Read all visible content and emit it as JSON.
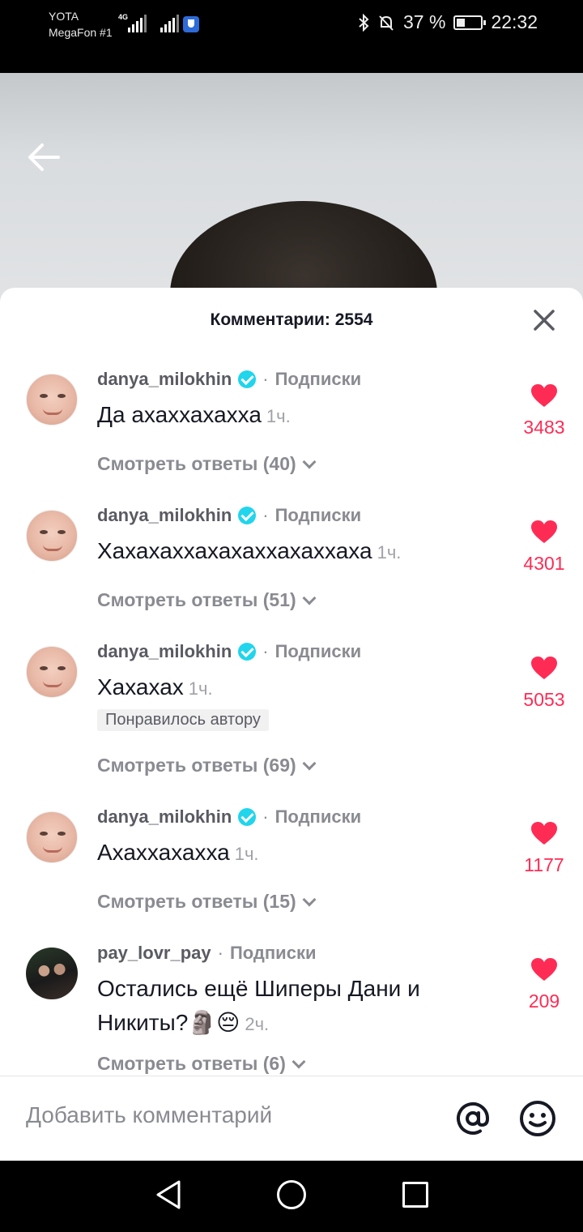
{
  "status_bar": {
    "carrier1": "YOTA",
    "carrier2": "MegaFon #1",
    "network": "4G",
    "battery": "37 %",
    "battery_level": 0.37,
    "time": "22:32"
  },
  "header": {
    "title": "Комментарии: 2554"
  },
  "comments": [
    {
      "username": "danya_milokhin",
      "verified": true,
      "follow_label": "Подписки",
      "text": "Да ахаххахахха",
      "time": "1ч.",
      "likes": "3483",
      "replies_label": "Смотреть ответы (40)"
    },
    {
      "username": "danya_milokhin",
      "verified": true,
      "follow_label": "Подписки",
      "text": "Хахахаххахахаххахаххаха",
      "time": "1ч.",
      "likes": "4301",
      "replies_label": "Смотреть ответы (51)"
    },
    {
      "username": "danya_milokhin",
      "verified": true,
      "follow_label": "Подписки",
      "text": "Хахахах",
      "time": "1ч.",
      "liked_by_author": "Понравилось автору",
      "likes": "5053",
      "replies_label": "Смотреть ответы (69)"
    },
    {
      "username": "danya_milokhin",
      "verified": true,
      "follow_label": "Подписки",
      "text": "Ахаххахахха",
      "time": "1ч.",
      "likes": "1177",
      "replies_label": "Смотреть ответы (15)"
    },
    {
      "username": "pay_lovr_pay",
      "verified": false,
      "follow_label": "Подписки",
      "text": "Остались ещё Шиперы Дани и Никиты?🗿😔",
      "time": "2ч.",
      "likes": "209",
      "replies_label": "Смотреть ответы (6)"
    }
  ],
  "input": {
    "placeholder": "Добавить комментарий"
  },
  "icons": {
    "back": "arrow-left-icon",
    "close": "close-icon",
    "like": "heart-icon",
    "mention": "at-sign-icon",
    "emoji": "smiley-icon"
  },
  "colors": {
    "accent_like": "#fe2c55",
    "verified": "#20d5ec"
  }
}
